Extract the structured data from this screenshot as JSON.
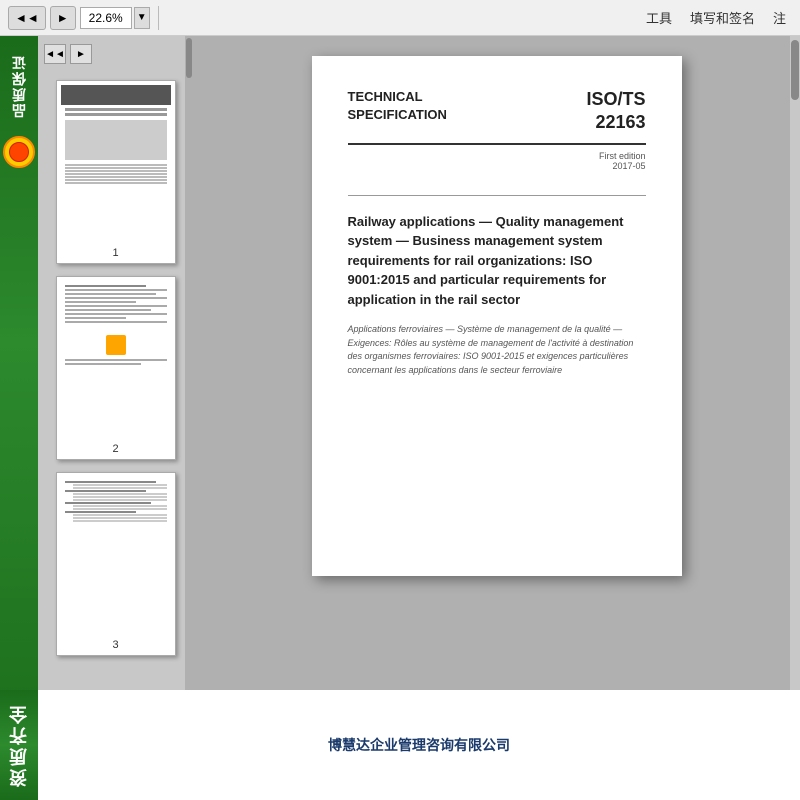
{
  "toolbar": {
    "zoom_value": "22.6%",
    "zoom_dropdown_arrow": "▼",
    "back_btn": "◄◄",
    "forward_btn": "►",
    "tools_label": "工具",
    "fill_sign_label": "填写和签名",
    "register_label": "注"
  },
  "left_badge": {
    "text": "品质保证"
  },
  "thumbnails": [
    {
      "label": "1"
    },
    {
      "label": "2"
    },
    {
      "label": "3"
    }
  ],
  "document": {
    "tech_spec_line1": "TECHNICAL",
    "tech_spec_line2": "SPECIFICATION",
    "iso_line1": "ISO/TS",
    "iso_line2": "22163",
    "edition": "First edition",
    "edition_date": "2017-05",
    "main_title": "Railway applications — Quality management system — Business management system requirements for rail organizations: ISO 9001:2015 and particular requirements for application in the rail sector",
    "subtitle": "Applications ferroviaires — Système de management de la qualité — Exigences: Rôles au système de management de l'activité à destination des organismes ferroviaires: ISO 9001-2015 et exigences particulières concernant les applications dans le secteur ferroviaire"
  },
  "bottom": {
    "badge_text": "资质齐全",
    "company_name": "博慧达企业管理咨询有限公司"
  }
}
